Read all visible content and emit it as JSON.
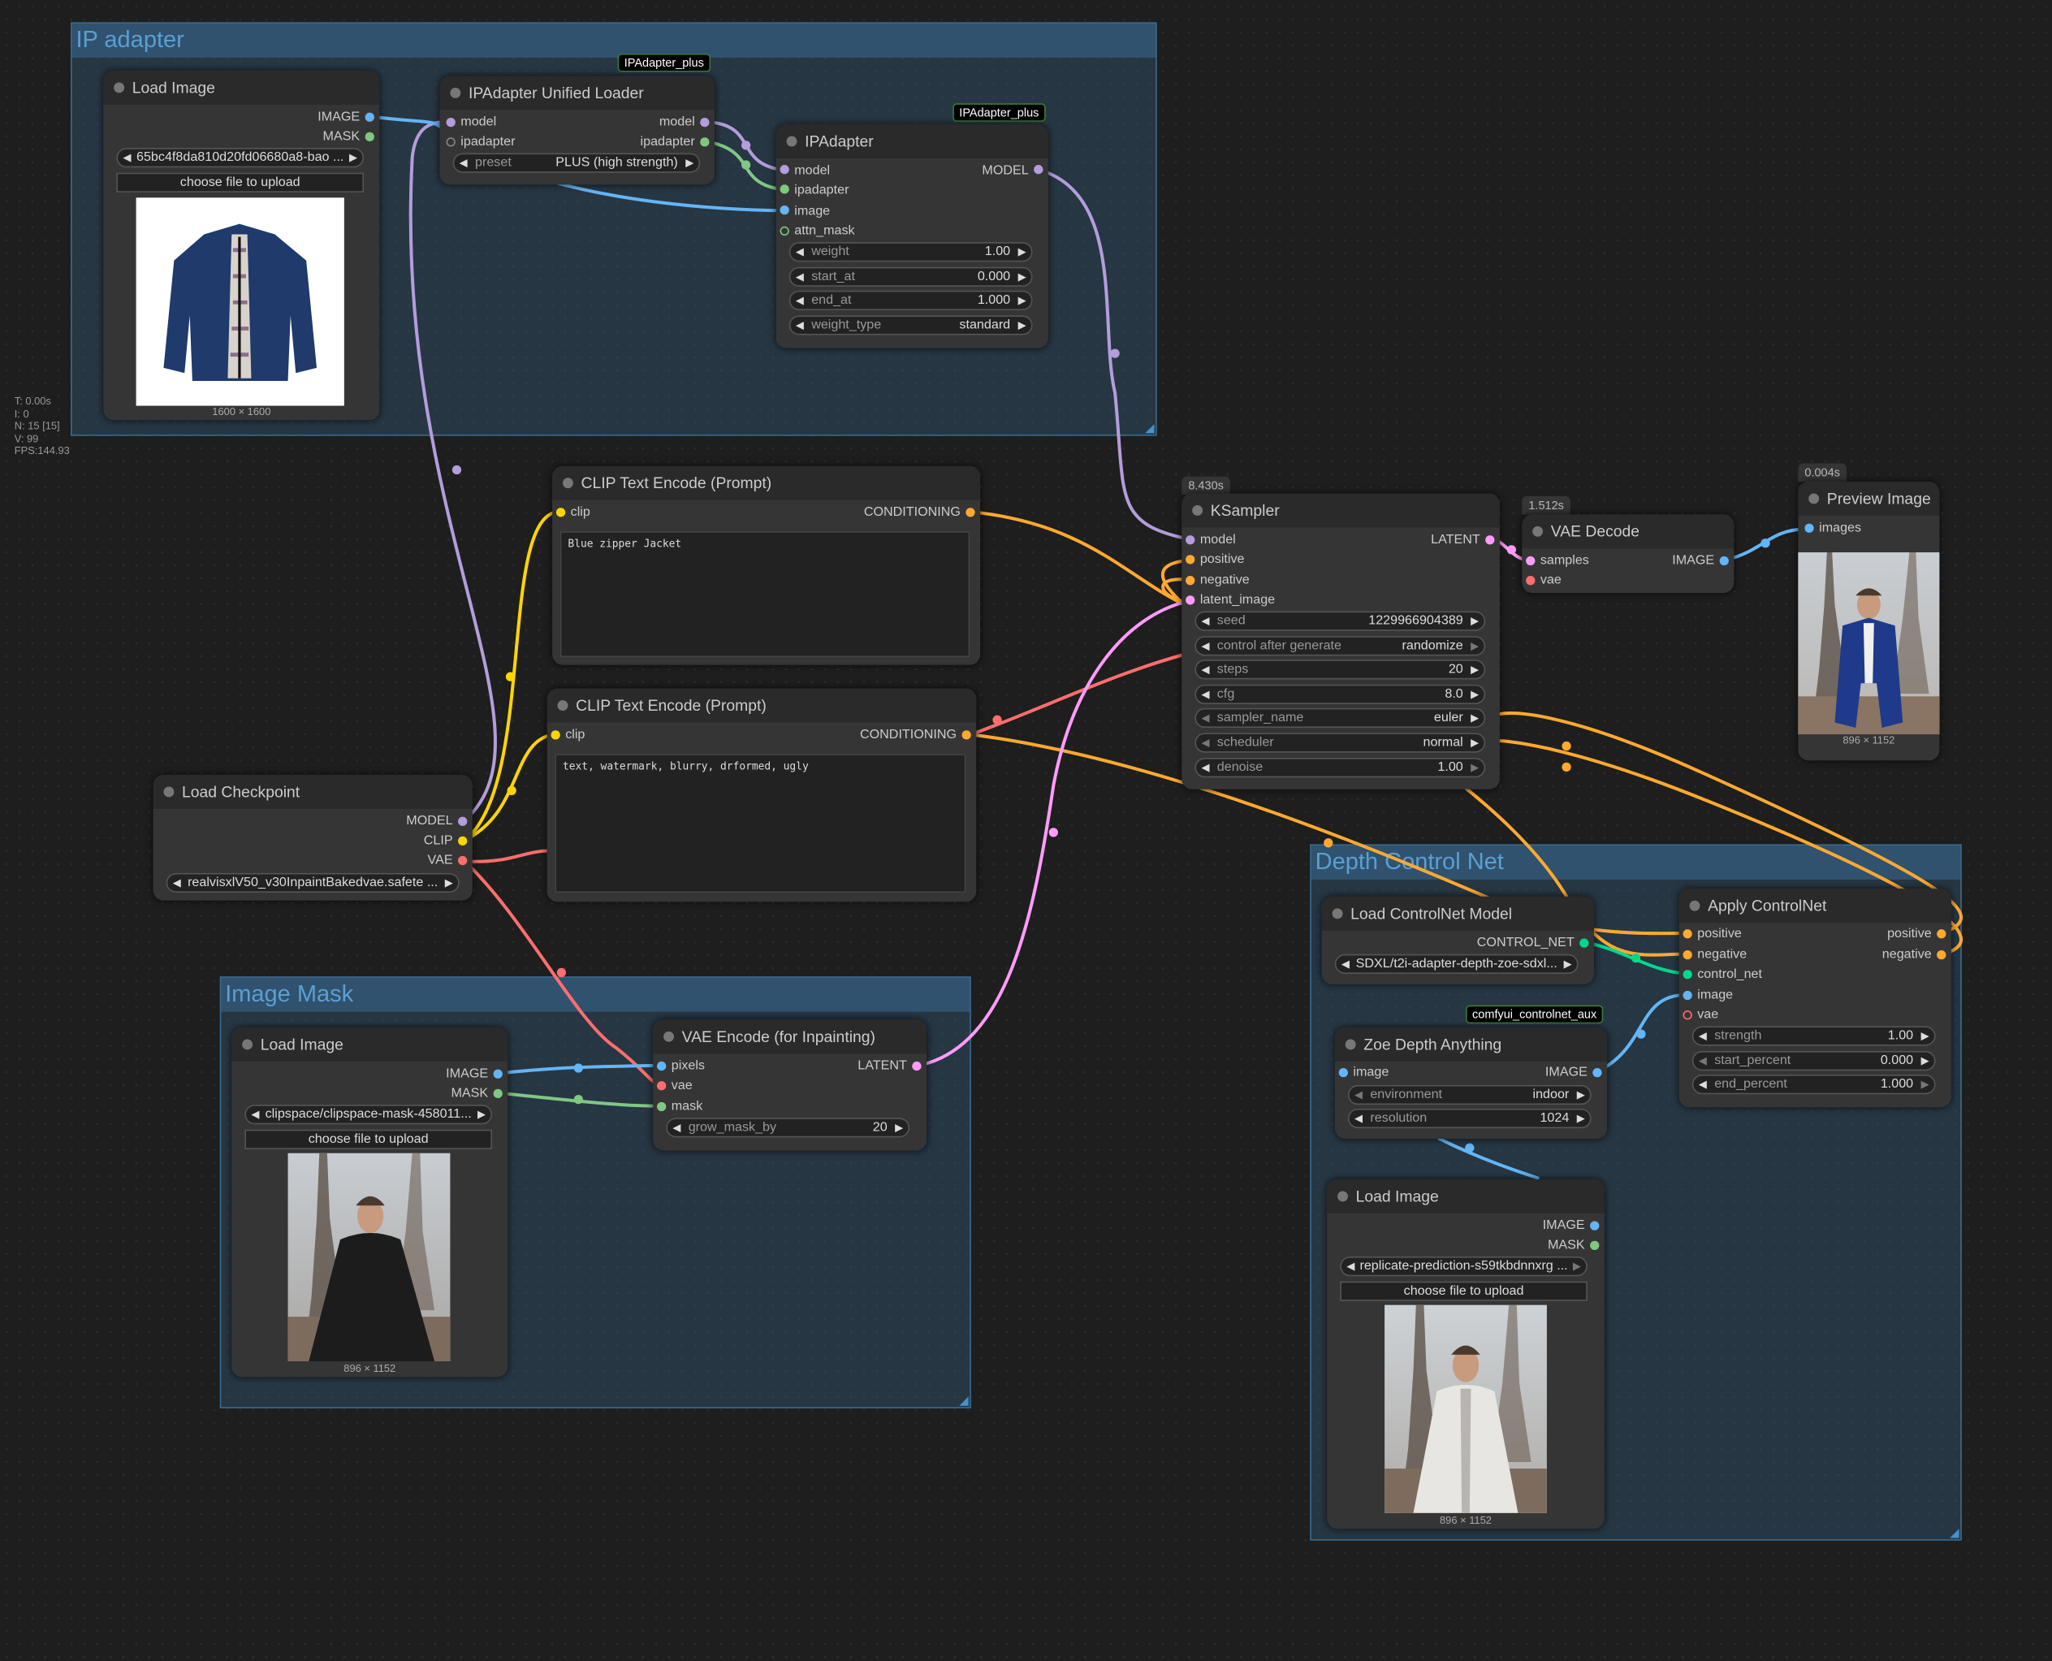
{
  "stats": {
    "t": "T: 0.00s",
    "i": "I: 0",
    "n": "N: 15 [15]",
    "v": "V: 99",
    "fps": "FPS:144.93"
  },
  "groups": {
    "ip_adapter": "IP adapter",
    "image_mask": "Image Mask",
    "depth": "Depth Control Net"
  },
  "badges": {
    "ipadapter_plus_1": "IPAdapter_plus",
    "ipadapter_plus_2": "IPAdapter_plus",
    "controlnet_aux": "comfyui_controlnet_aux"
  },
  "times": {
    "ksampler": "8.430s",
    "vae_decode": "1.512s",
    "preview": "0.004s"
  },
  "load_image_1": {
    "title": "Load Image",
    "out_image": "IMAGE",
    "out_mask": "MASK",
    "file": "65bc4f8da810d20fd06680a8-bao ...",
    "upload": "choose file to upload",
    "dims": "1600 × 1600"
  },
  "ipa_loader": {
    "title": "IPAdapter Unified Loader",
    "in_model": "model",
    "in_ipadapter": "ipadapter",
    "out_model": "model",
    "out_ipadapter": "ipadapter",
    "preset_label": "preset",
    "preset_value": "PLUS (high strength)"
  },
  "ipadapter": {
    "title": "IPAdapter",
    "in_model": "model",
    "in_ipadapter": "ipadapter",
    "in_image": "image",
    "in_attn_mask": "attn_mask",
    "out_model": "MODEL",
    "weight_label": "weight",
    "weight_value": "1.00",
    "start_label": "start_at",
    "start_value": "0.000",
    "end_label": "end_at",
    "end_value": "1.000",
    "type_label": "weight_type",
    "type_value": "standard"
  },
  "clip_pos": {
    "title": "CLIP Text Encode (Prompt)",
    "in_clip": "clip",
    "out": "CONDITIONING",
    "text": "Blue zipper Jacket"
  },
  "clip_neg": {
    "title": "CLIP Text Encode (Prompt)",
    "in_clip": "clip",
    "out": "CONDITIONING",
    "text": "text, watermark, blurry, drformed, ugly"
  },
  "checkpoint": {
    "title": "Load Checkpoint",
    "out_model": "MODEL",
    "out_clip": "CLIP",
    "out_vae": "VAE",
    "file": "realvisxlV50_v30InpaintBakedvae.safete ..."
  },
  "ksampler": {
    "title": "KSampler",
    "in_model": "model",
    "in_positive": "positive",
    "in_negative": "negative",
    "in_latent": "latent_image",
    "out_latent": "LATENT",
    "seed_label": "seed",
    "seed_value": "1229966904389",
    "cag_label": "control after generate",
    "cag_value": "randomize",
    "steps_label": "steps",
    "steps_value": "20",
    "cfg_label": "cfg",
    "cfg_value": "8.0",
    "sampler_label": "sampler_name",
    "sampler_value": "euler",
    "scheduler_label": "scheduler",
    "scheduler_value": "normal",
    "denoise_label": "denoise",
    "denoise_value": "1.00"
  },
  "vae_decode": {
    "title": "VAE Decode",
    "in_samples": "samples",
    "in_vae": "vae",
    "out_image": "IMAGE"
  },
  "preview": {
    "title": "Preview Image",
    "in_images": "images",
    "dims": "896 × 1152"
  },
  "load_image_2": {
    "title": "Load Image",
    "out_image": "IMAGE",
    "out_mask": "MASK",
    "file": "clipspace/clipspace-mask-458011...",
    "upload": "choose file to upload",
    "dims": "896 × 1152"
  },
  "vae_encode": {
    "title": "VAE Encode (for Inpainting)",
    "in_pixels": "pixels",
    "in_vae": "vae",
    "in_mask": "mask",
    "out_latent": "LATENT",
    "grow_label": "grow_mask_by",
    "grow_value": "20"
  },
  "cn_loader": {
    "title": "Load ControlNet Model",
    "out": "CONTROL_NET",
    "file": "SDXL/t2i-adapter-depth-zoe-sdxl..."
  },
  "apply_cn": {
    "title": "Apply ControlNet",
    "in_positive": "positive",
    "in_negative": "negative",
    "in_control_net": "control_net",
    "in_image": "image",
    "in_vae": "vae",
    "out_positive": "positive",
    "out_negative": "negative",
    "strength_label": "strength",
    "strength_value": "1.00",
    "start_label": "start_percent",
    "start_value": "0.000",
    "end_label": "end_percent",
    "end_value": "1.000"
  },
  "zoe": {
    "title": "Zoe Depth Anything",
    "in_image": "image",
    "out_image": "IMAGE",
    "env_label": "environment",
    "env_value": "indoor",
    "res_label": "resolution",
    "res_value": "1024"
  },
  "load_image_3": {
    "title": "Load Image",
    "out_image": "IMAGE",
    "out_mask": "MASK",
    "file": "replicate-prediction-s59tkbdnnxrg ...",
    "upload": "choose file to upload",
    "dims": "896 × 1152"
  },
  "colors": {
    "model": "#b39ddb",
    "clip": "#ffd500",
    "vae": "#ff6e6e",
    "conditioning": "#ffa931",
    "latent": "#ff9cf9",
    "image": "#64b5f6",
    "mask": "#81c784",
    "control_net": "#00d78d",
    "background": "#1e1e1e",
    "group": "#3a6a90"
  }
}
